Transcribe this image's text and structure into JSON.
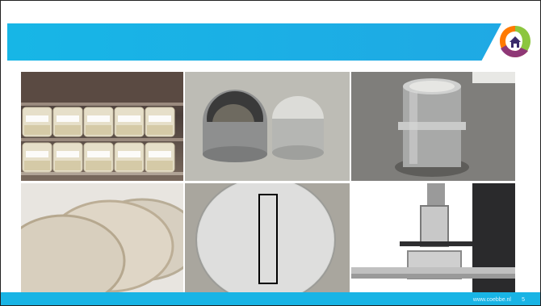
{
  "colors": {
    "header": "#17b6e6",
    "footer": "#18b4e5",
    "logo_orange": "#ff7a00",
    "logo_green": "#8cc63f",
    "logo_purple": "#7b2d8b",
    "logo_teal": "#00a0b0"
  },
  "logo": {
    "icon": "house-icon"
  },
  "footer": {
    "site": "www.coebbe.nl",
    "page": "5"
  }
}
